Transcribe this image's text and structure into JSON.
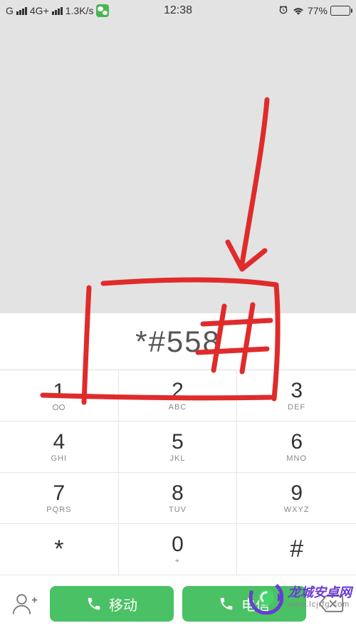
{
  "status": {
    "carrier_prefix": "G",
    "net_label": "4G+",
    "speed": "1.3K/s",
    "time": "12:38",
    "battery_pct_text": "77%",
    "battery_pct": 77
  },
  "dialer": {
    "entered": "*#558"
  },
  "keys": {
    "k1": {
      "digit": "1",
      "sub": ""
    },
    "k2": {
      "digit": "2",
      "sub": "ABC"
    },
    "k3": {
      "digit": "3",
      "sub": "DEF"
    },
    "k4": {
      "digit": "4",
      "sub": "GHI"
    },
    "k5": {
      "digit": "5",
      "sub": "JKL"
    },
    "k6": {
      "digit": "6",
      "sub": "MNO"
    },
    "k7": {
      "digit": "7",
      "sub": "PQRS"
    },
    "k8": {
      "digit": "8",
      "sub": "TUV"
    },
    "k9": {
      "digit": "9",
      "sub": "WXYZ"
    },
    "kstar": {
      "digit": "*"
    },
    "k0": {
      "digit": "0",
      "sub": "+"
    },
    "khash": {
      "digit": "#"
    }
  },
  "actions": {
    "sim1_label": "移动",
    "sim2_label": "电信"
  },
  "annotation": {
    "hash_overlay": "#"
  },
  "watermark": {
    "title": "龙城安卓网",
    "url": "www.lcjrfg.com"
  }
}
